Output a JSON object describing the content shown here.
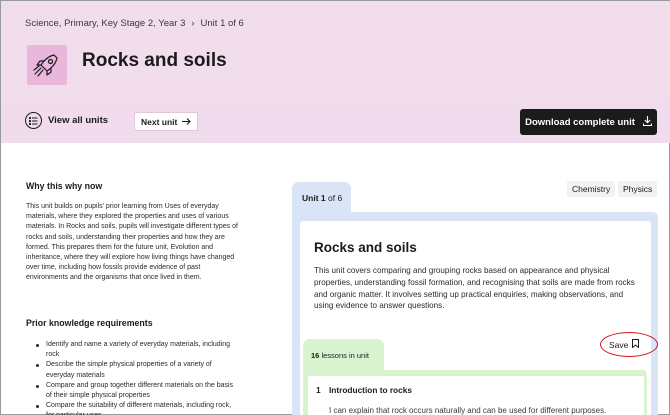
{
  "breadcrumb": {
    "path": "Science, Primary, Key Stage 2, Year 3",
    "separator": "›",
    "current": "Unit 1 of 6"
  },
  "page": {
    "title": "Rocks and soils"
  },
  "icons": {
    "unit": "rocket-icon",
    "view_all": "list-icon",
    "next": "arrow-right-icon",
    "download": "download-icon",
    "save": "bookmark-icon"
  },
  "colors": {
    "hero_bg": "#f2dded",
    "unit_icon_bg": "#e9b7dc",
    "download_bg": "#1b1b1b",
    "unit_card": "#d9e5f7",
    "lessons_card": "#d7f4cf",
    "highlight_ring": "#d8141c"
  },
  "toolbar": {
    "view_all_label": "View all units",
    "next_unit_label": "Next unit",
    "download_label": "Download complete unit"
  },
  "why": {
    "heading": "Why this why now",
    "body": "This unit builds on pupils' prior learning from Uses of everyday materials, where they explored the properties and uses of various materials. In Rocks and soils, pupils will investigate different types of rocks and soils, understanding their properties and how they are formed. This prepares them for the future unit, Evolution and inheritance, where they will explore how living things have changed over time, including how fossils provide evidence of past environments and the organisms that once lived in them."
  },
  "prior": {
    "heading": "Prior knowledge requirements",
    "items": [
      "Identify and name a variety of everyday materials, including rock",
      "Describe the simple physical properties of a variety of everyday materials",
      "Compare and group together different materials on the basis of their simple physical properties",
      "Compare the suitability of different materials, including rock, for particular uses"
    ]
  },
  "unit_card": {
    "unit_word": "Unit",
    "unit_number": "1",
    "of_text": "of 6",
    "tags": [
      "Chemistry",
      "Physics"
    ],
    "title": "Rocks and soils",
    "description": "This unit covers comparing and grouping rocks based on appearance and physical properties, understanding fossil formation, and recognising that soils are made from rocks and organic matter. It involves setting up practical enquiries, making observations, and using evidence to answer questions.",
    "save_label": "Save"
  },
  "lessons": {
    "count": "16",
    "count_label": "lessons in unit",
    "items": [
      {
        "number": "1",
        "title": "Introduction to rocks",
        "description": "I can explain that rock occurs naturally and can be used for different purposes."
      }
    ]
  }
}
